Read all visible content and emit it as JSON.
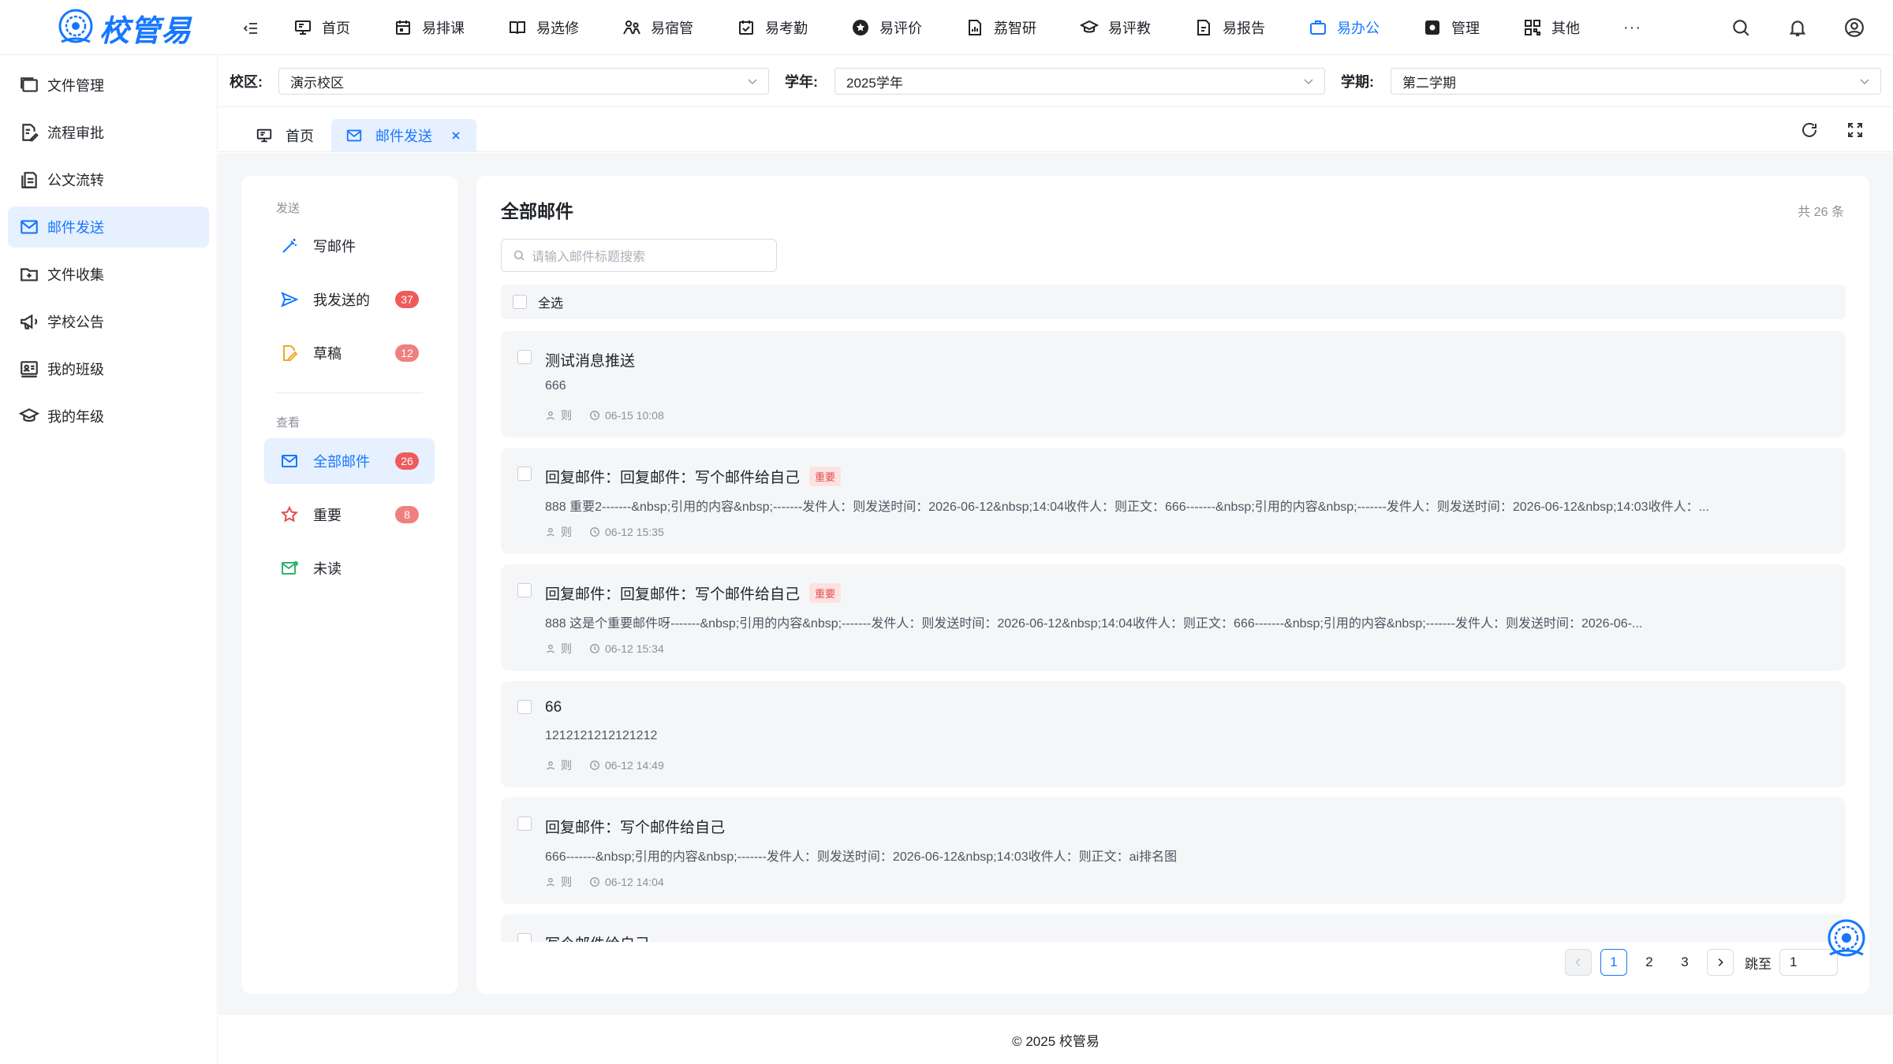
{
  "brand": {
    "name": "校管易"
  },
  "nav": {
    "items": [
      {
        "label": "首页",
        "icon": "monitor-icon"
      },
      {
        "label": "易排课",
        "icon": "calendar-icon"
      },
      {
        "label": "易选修",
        "icon": "book-icon"
      },
      {
        "label": "易宿管",
        "icon": "people-icon"
      },
      {
        "label": "易考勤",
        "icon": "calendar-check-icon"
      },
      {
        "label": "易评价",
        "icon": "star-circle-icon"
      },
      {
        "label": "荔智研",
        "icon": "document-chart-icon"
      },
      {
        "label": "易评教",
        "icon": "graduation-cap-icon"
      },
      {
        "label": "易报告",
        "icon": "report-icon"
      },
      {
        "label": "易办公",
        "icon": "briefcase-icon"
      },
      {
        "label": "管理",
        "icon": "settings-square-icon"
      },
      {
        "label": "其他",
        "icon": "grid-icon"
      }
    ],
    "more": "···"
  },
  "sidebar": {
    "items": [
      {
        "label": "文件管理"
      },
      {
        "label": "流程审批"
      },
      {
        "label": "公文流转"
      },
      {
        "label": "邮件发送"
      },
      {
        "label": "文件收集"
      },
      {
        "label": "学校公告"
      },
      {
        "label": "我的班级"
      },
      {
        "label": "我的年级"
      }
    ]
  },
  "filters": {
    "campus": {
      "label": "校区:",
      "value": "演示校区"
    },
    "year": {
      "label": "学年:",
      "value": "2025学年"
    },
    "term": {
      "label": "学期:",
      "value": "第二学期"
    }
  },
  "tabs": [
    {
      "label": "首页"
    },
    {
      "label": "邮件发送"
    }
  ],
  "mail_nav": {
    "send_title": "发送",
    "view_title": "查看",
    "compose": "写邮件",
    "sent": {
      "label": "我发送的",
      "count": "37"
    },
    "drafts": {
      "label": "草稿",
      "count": "12"
    },
    "all": {
      "label": "全部邮件",
      "count": "26"
    },
    "important": {
      "label": "重要",
      "count": "8"
    },
    "unread": {
      "label": "未读"
    }
  },
  "main": {
    "title": "全部邮件",
    "total": "共 26 条",
    "search_placeholder": "请输入邮件标题搜索",
    "select_all": "全选",
    "important_tag": "重要",
    "mails": [
      {
        "subject": "测试消息推送",
        "preview": "666",
        "sender": "则",
        "time": "06-15 10:08",
        "important": false
      },
      {
        "subject": "回复邮件：回复邮件：写个邮件给自己",
        "preview": "888 重要2-------&nbsp;引用的内容&nbsp;-------发件人：则发送时间：2026-06-12&nbsp;14:04收件人：则正文：666-------&nbsp;引用的内容&nbsp;-------发件人：则发送时间：2026-06-12&nbsp;14:03收件人：...",
        "sender": "则",
        "time": "06-12 15:35",
        "important": true
      },
      {
        "subject": "回复邮件：回复邮件：写个邮件给自己",
        "preview": "888 这是个重要邮件呀-------&nbsp;引用的内容&nbsp;-------发件人：则发送时间：2026-06-12&nbsp;14:04收件人：则正文：666-------&nbsp;引用的内容&nbsp;-------发件人：则发送时间：2026-06-...",
        "sender": "则",
        "time": "06-12 15:34",
        "important": true
      },
      {
        "subject": "66",
        "preview": "1212121212121212",
        "sender": "则",
        "time": "06-12 14:49",
        "important": false
      },
      {
        "subject": "回复邮件：写个邮件给自己",
        "preview": "666-------&nbsp;引用的内容&nbsp;-------发件人：则发送时间：2026-06-12&nbsp;14:03收件人：则正文：ai排名图",
        "sender": "则",
        "time": "06-12 14:04",
        "important": false
      },
      {
        "subject": "写个邮件给自己",
        "preview": "",
        "sender": "",
        "time": "",
        "important": false
      }
    ]
  },
  "pagination": {
    "pages": [
      "1",
      "2",
      "3"
    ],
    "current": "1",
    "jump_label": "跳至",
    "jump_value": "1"
  },
  "footer": {
    "text": "© 2025 校管易"
  },
  "colors": {
    "accent": "#1677ff",
    "active_bg": "#e6f0ff",
    "badge_red": "#ef5b5b",
    "page_bg": "#f5f6f8"
  }
}
